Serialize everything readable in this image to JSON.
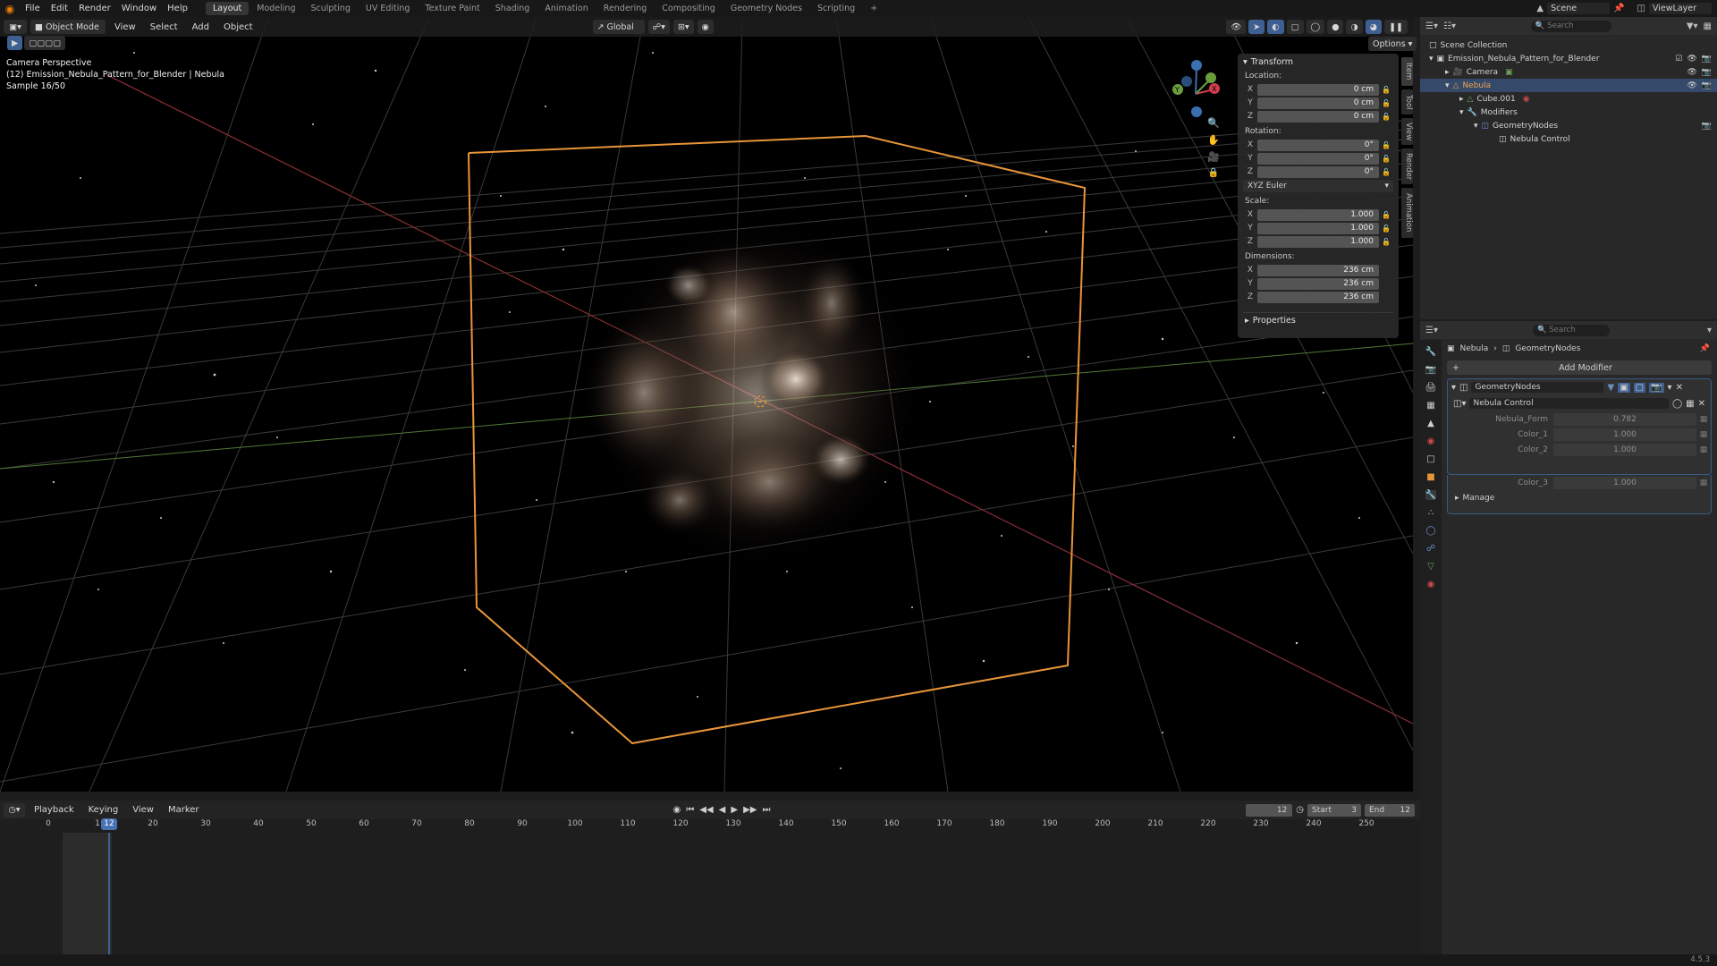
{
  "menu": {
    "items": [
      "File",
      "Edit",
      "Render",
      "Window",
      "Help"
    ]
  },
  "workspaces": [
    "Layout",
    "Modeling",
    "Sculpting",
    "UV Editing",
    "Texture Paint",
    "Shading",
    "Animation",
    "Rendering",
    "Compositing",
    "Geometry Nodes",
    "Scripting"
  ],
  "active_workspace": "Layout",
  "scene": {
    "name": "Scene",
    "view_layer": "ViewLayer"
  },
  "viewport": {
    "mode": "Object Mode",
    "menus": [
      "View",
      "Select",
      "Add",
      "Object"
    ],
    "orientation": "Global",
    "options_label": "Options",
    "overlay_lines": [
      "Camera Perspective",
      "(12) Emission_Nebula_Pattern_for_Blender | Nebula",
      "Sample 16/50"
    ]
  },
  "npanel": {
    "title": "Transform",
    "location_label": "Location:",
    "location": [
      "0 cm",
      "0 cm",
      "0 cm"
    ],
    "rotation_label": "Rotation:",
    "rotation": [
      "0°",
      "0°",
      "0°"
    ],
    "rotation_mode": "XYZ Euler",
    "scale_label": "Scale:",
    "scale": [
      "1.000",
      "1.000",
      "1.000"
    ],
    "dimensions_label": "Dimensions:",
    "dimensions": [
      "236 cm",
      "236 cm",
      "236 cm"
    ],
    "properties_label": "Properties",
    "axes": [
      "X",
      "Y",
      "Z"
    ],
    "tabs": [
      "Item",
      "Tool",
      "View",
      "Render",
      "Animation"
    ]
  },
  "outliner": {
    "search_placeholder": "Search",
    "root": "Scene Collection",
    "collection": "Emission_Nebula_Pattern_for_Blender",
    "items": [
      "Camera",
      "Nebula",
      "Cube.001",
      "Modifiers",
      "GeometryNodes",
      "Nebula Control"
    ]
  },
  "properties": {
    "search_placeholder": "Search",
    "breadcrumb_object": "Nebula",
    "breadcrumb_modifier": "GeometryNodes",
    "add_modifier": "Add Modifier",
    "modifier_name": "GeometryNodes",
    "node_group": "Nebula Control",
    "inputs": [
      {
        "label": "Nebula_Form",
        "value": "0.782"
      },
      {
        "label": "Color_1",
        "value": "1.000"
      },
      {
        "label": "Color_2",
        "value": "1.000"
      },
      {
        "label": "Color_3",
        "value": "1.000"
      }
    ],
    "manage_label": "Manage"
  },
  "timeline": {
    "menus": [
      "Playback",
      "Keying",
      "View",
      "Marker"
    ],
    "current_frame": "12",
    "start_label": "Start",
    "start": "3",
    "end_label": "End",
    "end": "12",
    "ruler": [
      "0",
      "1",
      "20",
      "30",
      "40",
      "50",
      "60",
      "70",
      "80",
      "90",
      "100",
      "110",
      "120",
      "130",
      "140",
      "150",
      "160",
      "170",
      "180",
      "190",
      "200",
      "210",
      "220",
      "230",
      "240",
      "250"
    ],
    "playhead_label": "12"
  },
  "status": {
    "version": "4.5.3"
  },
  "colors": {
    "accent": "#4772b3",
    "selection": "#e8953a",
    "background": "#000000"
  }
}
